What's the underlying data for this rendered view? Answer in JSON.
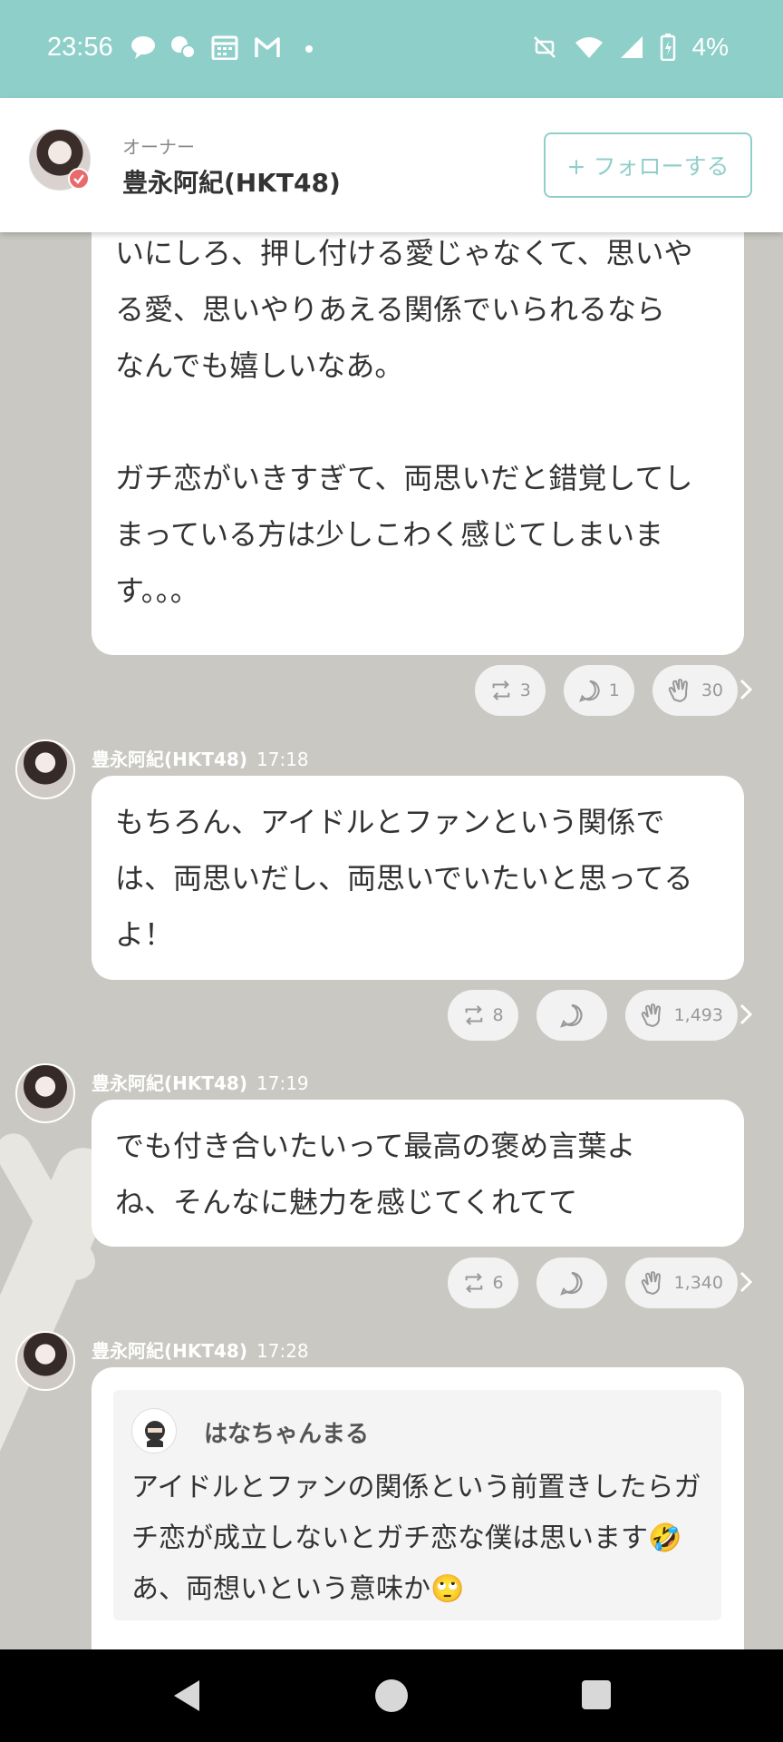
{
  "status_bar": {
    "time": "23:56",
    "battery": "4%",
    "icons": [
      "line-icon",
      "chat-icon",
      "calendar-icon",
      "gmail-icon",
      "mute-icon",
      "wifi-icon",
      "signal-icon",
      "battery-charging-icon"
    ]
  },
  "header": {
    "role": "オーナー",
    "name": "豊永阿紀(HKT48)",
    "follow_label": "+ フォローする",
    "accent": "#8fcfca"
  },
  "messages": [
    {
      "author": "",
      "time": "",
      "text": "いにしろ、押し付ける愛じゃなくて、思いや\nる愛、思いやりあえる関係でいられるなら\nなんでも嬉しいなあ。\n\nガチ恋がいきすぎて、両思いだと錯覚してし\nまっている方は少しこわく感じてしまいま\nす。。。",
      "reposts": "3",
      "replies": "1",
      "claps": "30"
    },
    {
      "author": "豊永阿紀(HKT48)",
      "time": "17:18",
      "text": "もちろん、アイドルとファンという関係で\nは、両思いだし、両思いでいたいと思ってる\nよ！",
      "reposts": "8",
      "replies": "",
      "claps": "1,493"
    },
    {
      "author": "豊永阿紀(HKT48)",
      "time": "17:19",
      "text": "でも付き合いたいって最高の褒め言葉よ\nね、そんなに魅力を感じてくれてて",
      "reposts": "6",
      "replies": "",
      "claps": "1,340"
    },
    {
      "author": "豊永阿紀(HKT48)",
      "time": "17:28",
      "quote": {
        "name": "はなちゃんまる",
        "text": "アイドルとファンの関係という前置きしたらガ\nチ恋が成立しないとガチ恋な僕は思います🤣\nあ、両想いという意味か🙄"
      }
    }
  ]
}
